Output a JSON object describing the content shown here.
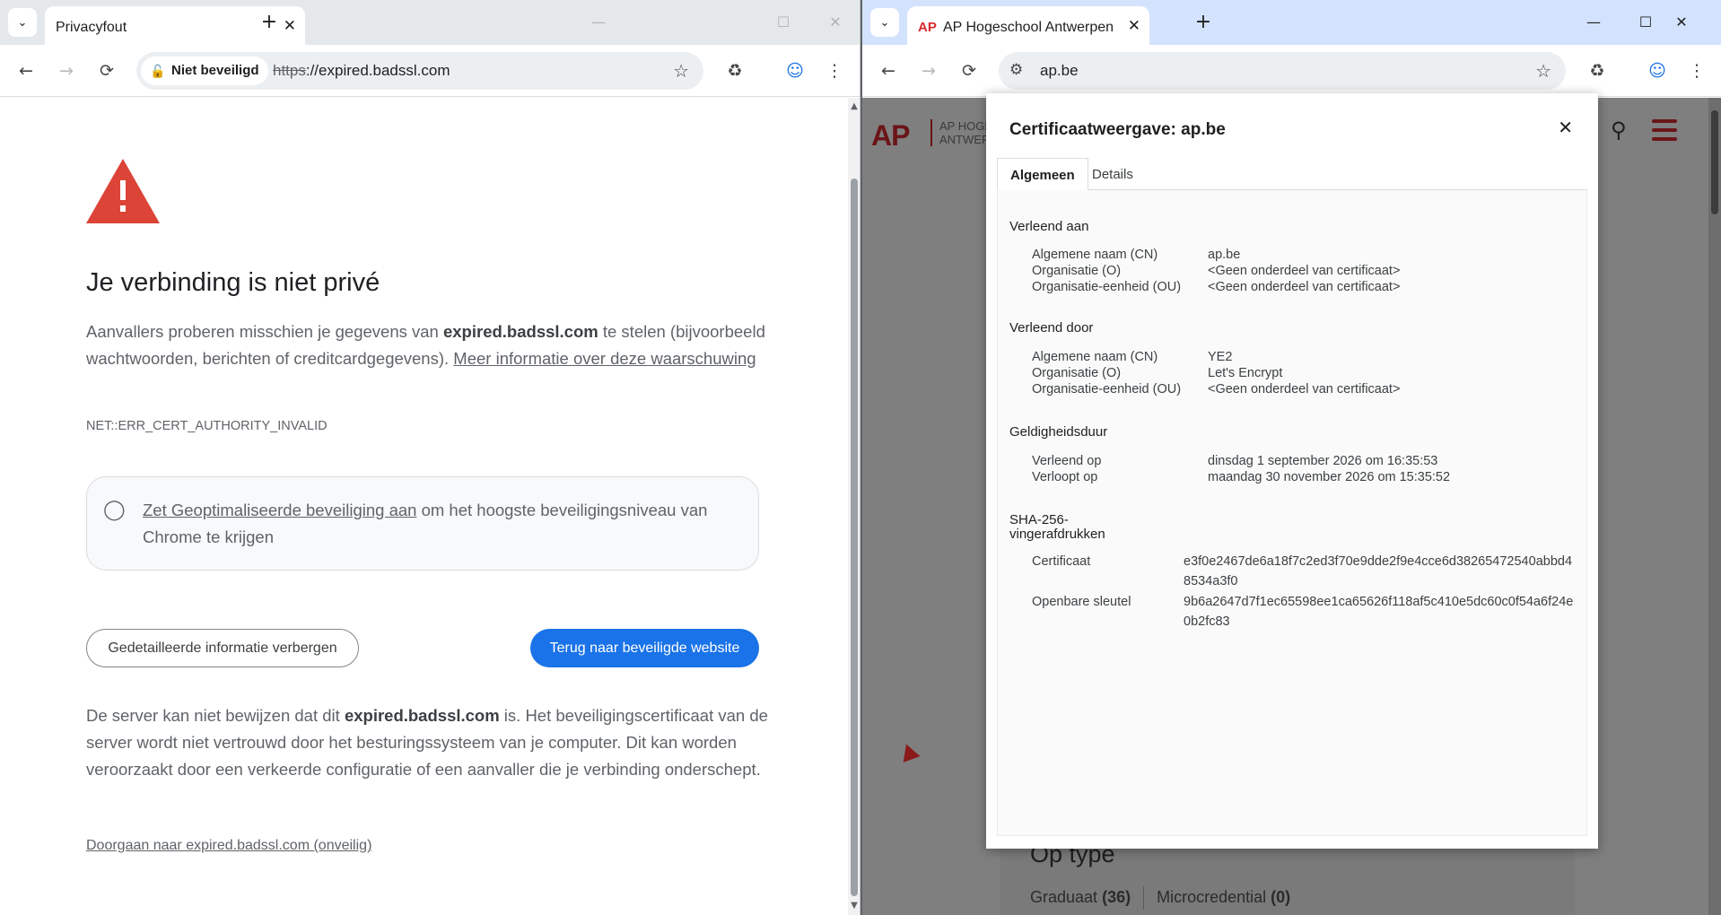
{
  "left_window": {
    "tab": {
      "title": "Privacyfout"
    },
    "toolbar": {
      "security_chip": "Niet beveiligd",
      "url_scheme": "https",
      "url_rest": "://expired.badssl.com"
    },
    "page": {
      "heading": "Je verbinding is niet privé",
      "intro_pre": "Aanvallers proberen misschien je gegevens van ",
      "intro_host": "expired.badssl.com",
      "intro_mid": " te stelen (bijvoorbeeld wachtwoorden, berichten of creditcardgegevens). ",
      "intro_link": "Meer informatie over deze waarschuwing",
      "error_code": "NET::ERR_CERT_AUTHORITY_INVALID",
      "tip_link": "Zet Geoptimaliseerde beveiliging aan",
      "tip_rest": " om het hoogste beveiligingsniveau van Chrome te krijgen",
      "btn_details": "Gedetailleerde informatie verbergen",
      "btn_back": "Terug naar beveiligde website",
      "detail_pre": "De server kan niet bewijzen dat dit ",
      "detail_host": "expired.badssl.com",
      "detail_rest": " is. Het beveiligingscertificaat van de server wordt niet vertrouwd door het besturingssysteem van je computer. Dit kan worden veroorzaakt door een verkeerde configuratie of een aanvaller die je verbinding onderschept.",
      "proceed_link": "Doorgaan naar expired.badssl.com (onveilig)"
    }
  },
  "right_window": {
    "tab": {
      "title": "AP Hogeschool Antwerpen",
      "favicon_text": "AP"
    },
    "toolbar": {
      "url": "ap.be"
    },
    "background_page": {
      "logo": "AP",
      "name_line1": "AP HOGE",
      "name_line2": "ANTWER",
      "section_title": "Op type",
      "filter1_label": "Graduaat",
      "filter1_count": "(36)",
      "filter2_label": "Microcredential",
      "filter2_count": "(0)"
    },
    "dialog": {
      "title": "Certificaatweergave: ap.be",
      "tabs": [
        "Algemeen",
        "Details"
      ],
      "issued_to": {
        "heading": "Verleend aan",
        "rows": [
          {
            "k": "Algemene naam (CN)",
            "v": "ap.be"
          },
          {
            "k": "Organisatie (O)",
            "v": "<Geen onderdeel van certificaat>"
          },
          {
            "k": "Organisatie-eenheid (OU)",
            "v": "<Geen onderdeel van certificaat>"
          }
        ]
      },
      "issued_by": {
        "heading": "Verleend door",
        "rows": [
          {
            "k": "Algemene naam (CN)",
            "v": "YE2"
          },
          {
            "k": "Organisatie (O)",
            "v": "Let's Encrypt"
          },
          {
            "k": "Organisatie-eenheid (OU)",
            "v": "<Geen onderdeel van certificaat>"
          }
        ]
      },
      "validity": {
        "heading": "Geldigheidsduur",
        "rows": [
          {
            "k": "Verleend op",
            "v": "dinsdag 1 september 2026 om 16:35:53"
          },
          {
            "k": "Verloopt op",
            "v": "maandag 30 november 2026 om 15:35:52"
          }
        ]
      },
      "fingerprints": {
        "heading_line1": "SHA-256-",
        "heading_line2": "vingerafdrukken",
        "rows": [
          {
            "k": "Certificaat",
            "v": "e3f0e2467de6a18f7c2ed3f70e9dde2f9e4cce6d38265472540abbd48534a3f0"
          },
          {
            "k": "Openbare sleutel",
            "v": "9b6a2647d7f1ec65598ee1ca65626f118af5c410e5dc60c0f54a6f24e0b2fc83"
          }
        ]
      }
    }
  },
  "colors": {
    "warning_red": "#db4437",
    "primary_blue": "#1a73e8",
    "ap_red": "#6b1518"
  },
  "icons": [
    "chevron-down-icon",
    "close-icon",
    "plus-icon",
    "minimize-icon",
    "maximize-icon",
    "back-arrow-icon",
    "forward-arrow-icon",
    "reload-icon",
    "unlock-icon",
    "star-icon",
    "extensions-icon",
    "profile-icon",
    "more-vert-icon",
    "warning-triangle-icon",
    "lightbulb-icon",
    "site-settings-icon",
    "search-icon",
    "hamburger-menu-icon"
  ]
}
